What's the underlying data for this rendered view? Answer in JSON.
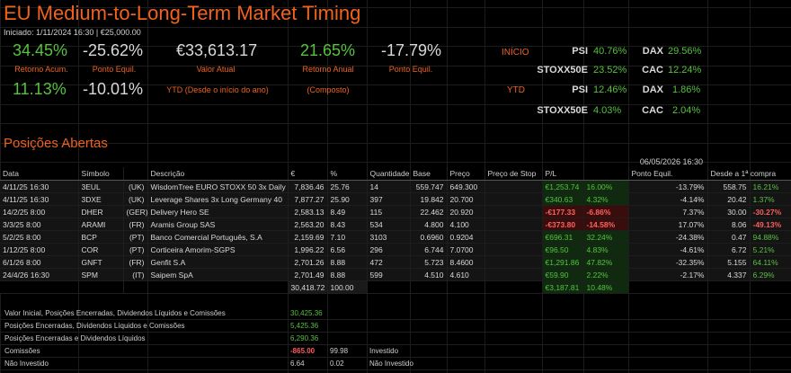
{
  "title": "EU Medium-to-Long-Term Market Timing",
  "subtitle": "Iniciado: 1/11/2024 16:30 | €25,000.00",
  "kpis": {
    "retorno_acum": {
      "value": "34.45%",
      "label": "Retorno Acum."
    },
    "ponto_equil_1": {
      "value": "-25.62%",
      "label": "Ponto Equil."
    },
    "valor_atual": {
      "value": "€33,613.17",
      "label": "Valor Atual"
    },
    "retorno_anual": {
      "value": "21.65%",
      "label": "Retorno Anual",
      "sub": "(Composto)"
    },
    "ponto_equil_2": {
      "value": "-17.79%",
      "label": "Ponto Equil."
    },
    "ytd_value": "11.13%",
    "ytd_pe": "-10.01%",
    "ytd_label": "YTD (Desde o início do ano)"
  },
  "markets": {
    "inicio_label": "INÍCIO",
    "ytd_label": "YTD",
    "inicio": [
      {
        "name": "PSI",
        "value": "40.76%"
      },
      {
        "name": "DAX",
        "value": "29.56%"
      },
      {
        "name": "STOXX50E",
        "value": "23.52%"
      },
      {
        "name": "CAC",
        "value": "12.24%"
      }
    ],
    "ytd": [
      {
        "name": "PSI",
        "value": "12.46%"
      },
      {
        "name": "DAX",
        "value": "1.86%"
      },
      {
        "name": "STOXX50E",
        "value": "4.03%"
      },
      {
        "name": "CAC",
        "value": "2.04%"
      }
    ]
  },
  "positions": {
    "section_title": "Posições Abertas",
    "as_of": "06/05/2026 16:30",
    "headers": [
      "Data",
      "Símbolo",
      "",
      "Descrição",
      "€",
      "%",
      "Quantidade",
      "Base",
      "Preço",
      "Preço de Stop",
      "P/L",
      "",
      "Ponto Equil.",
      "Desde a 1ª compra",
      ""
    ],
    "rows": [
      {
        "data": "4/11/25 16:30",
        "sym": "3EUL",
        "mkt": "(UK)",
        "desc": "WisdomTree EURO STOXX 50 3x Daily",
        "eur": "7,836.46",
        "pct": "25.76",
        "qty": "14",
        "base": "559.747",
        "preco": "649.300",
        "stop": "",
        "pl": "€1,253.74",
        "plpct": "16.00%",
        "pe": "-13.79%",
        "d1": "558.75",
        "d2": "16.21%",
        "neg": false,
        "d2neg": false
      },
      {
        "data": "4/11/25 16:30",
        "sym": "3DXE",
        "mkt": "(UK)",
        "desc": "Leverage Shares 3x Long Germany 40",
        "eur": "7,877.27",
        "pct": "25.90",
        "qty": "397",
        "base": "19.842",
        "preco": "20.700",
        "stop": "",
        "pl": "€340.63",
        "plpct": "4.32%",
        "pe": "-4.14%",
        "d1": "20.42",
        "d2": "1.37%",
        "neg": false,
        "d2neg": false
      },
      {
        "data": "14/2/25 8:00",
        "sym": "DHER",
        "mkt": "(GER)",
        "desc": "Delivery Hero SE",
        "eur": "2,583.13",
        "pct": "8.49",
        "qty": "115",
        "base": "22.462",
        "preco": "20.920",
        "stop": "",
        "pl": "-€177.33",
        "plpct": "-6.86%",
        "pe": "7.37%",
        "d1": "30.00",
        "d2": "-30.27%",
        "neg": true,
        "d2neg": true
      },
      {
        "data": "3/3/25 8:00",
        "sym": "ARAMI",
        "mkt": "(FR)",
        "desc": "Aramis Group SAS",
        "eur": "2,563.20",
        "pct": "8.43",
        "qty": "534",
        "base": "4.800",
        "preco": "4.100",
        "stop": "",
        "pl": "-€373.80",
        "plpct": "-14.58%",
        "pe": "17.07%",
        "d1": "8.06",
        "d2": "-49.13%",
        "neg": true,
        "d2neg": true
      },
      {
        "data": "5/2/25 8:00",
        "sym": "BCP",
        "mkt": "(PT)",
        "desc": "Banco Comercial Português, S.A",
        "eur": "2,159.69",
        "pct": "7.10",
        "qty": "3103",
        "base": "0.6960",
        "preco": "0.9204",
        "stop": "",
        "pl": "€696.31",
        "plpct": "32.24%",
        "pe": "-24.38%",
        "d1": "0.47",
        "d2": "94.88%",
        "neg": false,
        "d2neg": false
      },
      {
        "data": "1/12/25 8:00",
        "sym": "COR",
        "mkt": "(PT)",
        "desc": "Corticeira Amorim-SGPS",
        "eur": "1,996.22",
        "pct": "6.56",
        "qty": "296",
        "base": "6.744",
        "preco": "7.0700",
        "stop": "",
        "pl": "€96.50",
        "plpct": "4.83%",
        "pe": "-4.61%",
        "d1": "6.72",
        "d2": "5.21%",
        "neg": false,
        "d2neg": false
      },
      {
        "data": "6/1/26 8:00",
        "sym": "GNFT",
        "mkt": "(FR)",
        "desc": "Genfit S.A",
        "eur": "2,701.26",
        "pct": "8.88",
        "qty": "472",
        "base": "5.723",
        "preco": "8.4600",
        "stop": "",
        "pl": "€1,291.86",
        "plpct": "47.82%",
        "pe": "-32.35%",
        "d1": "5.155",
        "d2": "64.11%",
        "neg": false,
        "d2neg": false
      },
      {
        "data": "24/4/26 16:30",
        "sym": "SPM",
        "mkt": "(IT)",
        "desc": "Saipem SpA",
        "eur": "2,701.49",
        "pct": "8.88",
        "qty": "599",
        "base": "4.510",
        "preco": "4.610",
        "stop": "",
        "pl": "€59.90",
        "plpct": "2.22%",
        "pe": "-2.17%",
        "d1": "4.337",
        "d2": "6.29%",
        "neg": false,
        "d2neg": false
      }
    ],
    "total": {
      "eur": "30,418.72",
      "pct": "100.00",
      "pl": "€3,187.81",
      "plpct": "10.48%"
    }
  },
  "summary": [
    {
      "label": "Valor Inicial, Posições Encerradas, Dividendos Líquidos e Comissões",
      "value": "30,425.36",
      "value_color": "green",
      "c2": "",
      "c3": ""
    },
    {
      "label": "Posições Encerradas, Dividendos Líquidos e Comissões",
      "value": "5,425.36",
      "value_color": "green",
      "c2": "",
      "c3": ""
    },
    {
      "label": "Posições Encerradas e Dividendos Líquidos",
      "value": "6,290.36",
      "value_color": "green",
      "c2": "",
      "c3": ""
    },
    {
      "label": "Comissões",
      "value": "-865.00",
      "value_color": "red",
      "c2": "99.98",
      "c3": "Investido"
    },
    {
      "label": "Não Investido",
      "value": "6.64",
      "value_color": "grey",
      "c2": "0.02",
      "c3": "Não Investido"
    }
  ]
}
